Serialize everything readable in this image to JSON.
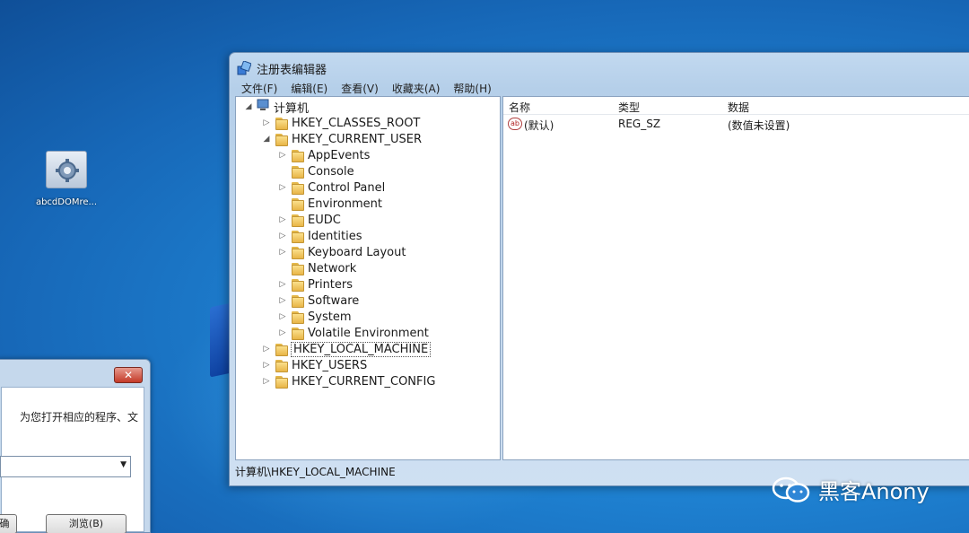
{
  "desktop": {
    "icon_label": "abcdDOMre..."
  },
  "dialog": {
    "close_glyph": "✕",
    "description": "为您打开相应的程序、文",
    "combo_arrow": "▼",
    "button_a_label": "确",
    "button_b_label": "浏览(B)"
  },
  "regedit": {
    "title": "注册表编辑器",
    "menu": [
      "文件(F)",
      "编辑(E)",
      "查看(V)",
      "收藏夹(A)",
      "帮助(H)"
    ],
    "tree": {
      "root": "计算机",
      "hives": {
        "classes_root": "HKEY_CLASSES_ROOT",
        "current_user": "HKEY_CURRENT_USER",
        "local_machine": "HKEY_LOCAL_MACHINE",
        "users": "HKEY_USERS",
        "current_config": "HKEY_CURRENT_CONFIG"
      },
      "current_user_children": [
        "AppEvents",
        "Console",
        "Control Panel",
        "Environment",
        "EUDC",
        "Identities",
        "Keyboard Layout",
        "Network",
        "Printers",
        "Software",
        "System",
        "Volatile Environment"
      ],
      "selected": "HKEY_LOCAL_MACHINE"
    },
    "list": {
      "headers": [
        "名称",
        "类型",
        "数据"
      ],
      "rows": [
        {
          "name": "(默认)",
          "type": "REG_SZ",
          "data": "(数值未设置)",
          "icon": "ab"
        }
      ]
    },
    "status_path": "计算机\\HKEY_LOCAL_MACHINE"
  },
  "watermark": {
    "text": "黑客Anony"
  }
}
